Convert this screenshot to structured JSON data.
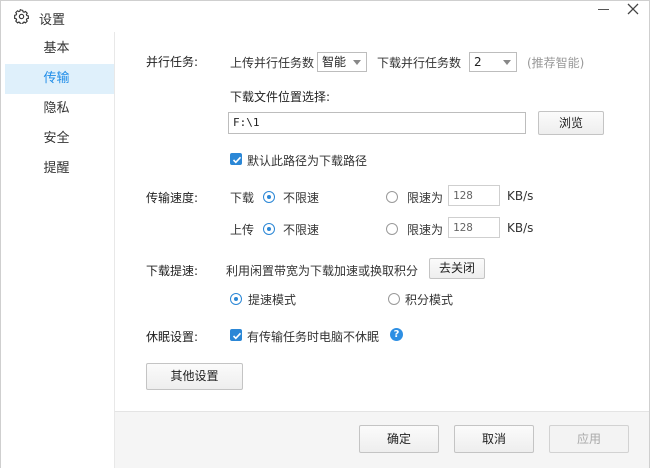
{
  "window": {
    "title": "设置",
    "icon": "gear-icon"
  },
  "sidebar": {
    "items": [
      {
        "label": "基本",
        "active": false
      },
      {
        "label": "传输",
        "active": true
      },
      {
        "label": "隐私",
        "active": false
      },
      {
        "label": "安全",
        "active": false
      },
      {
        "label": "提醒",
        "active": false
      }
    ]
  },
  "parallel": {
    "section_label": "并行任务:",
    "upload_label": "上传并行任务数",
    "upload_value": "智能",
    "download_label": "下载并行任务数",
    "download_value": "2",
    "hint": "(推荐智能)"
  },
  "download_location": {
    "label": "下载文件位置选择:",
    "path": "F:\\1",
    "browse_label": "浏览",
    "default_checkbox_label": "默认此路径为下载路径",
    "default_checked": true
  },
  "speed": {
    "section_label": "传输速度:",
    "download": {
      "label": "下载",
      "unlimited_label": "不限速",
      "limit_label": "限速为",
      "limit_value": "128",
      "unit": "KB/s",
      "selected": "unlimited"
    },
    "upload": {
      "label": "上传",
      "unlimited_label": "不限速",
      "limit_label": "限速为",
      "limit_value": "128",
      "unit": "KB/s",
      "selected": "unlimited"
    }
  },
  "boost": {
    "section_label": "下载提速:",
    "description": "利用闲置带宽为下载加速或换取积分",
    "close_button": "去关闭",
    "mode_speed_label": "提速模式",
    "mode_points_label": "积分模式",
    "selected": "speed"
  },
  "sleep": {
    "section_label": "休眠设置:",
    "checkbox_label": "有传输任务时电脑不休眠",
    "checked": true,
    "help_glyph": "?"
  },
  "other_settings_button": "其他设置",
  "footer": {
    "ok": "确定",
    "cancel": "取消",
    "apply": "应用"
  },
  "colors": {
    "accent": "#2b87d6",
    "active_nav_bg": "#dff0fb",
    "active_nav_text": "#1e8ce8"
  }
}
